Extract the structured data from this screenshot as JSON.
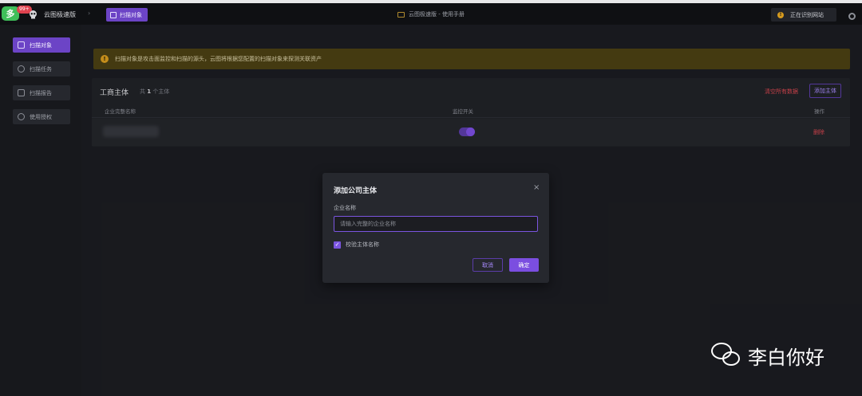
{
  "topbar": {
    "brand_badge": "多",
    "brand_count": "99+",
    "app_name": "云图极速版",
    "current_tab": "扫描对象",
    "center_title": "云图极速版 - 使用手册",
    "status_label": "正在识别网站"
  },
  "sidebar": {
    "items": [
      {
        "label": "扫描对象",
        "icon": "database-icon"
      },
      {
        "label": "扫描任务",
        "icon": "clock-icon"
      },
      {
        "label": "扫描报告",
        "icon": "report-icon"
      },
      {
        "label": "使用授权",
        "icon": "user-icon"
      }
    ]
  },
  "banner": {
    "text": "扫描对象是攻击面监控和扫描的源头，云图将根据您配置的扫描对象来探测关联资产"
  },
  "panel": {
    "title": "工商主体",
    "count_prefix": "共",
    "count_value": "1",
    "count_suffix": "个主体",
    "clear_label": "清空所有数据",
    "add_label": "添加主体",
    "columns": [
      "企业完整名称",
      "监控开关",
      "操作"
    ],
    "rows": [
      {
        "monitor_on": true,
        "action": "删除"
      }
    ]
  },
  "modal": {
    "title": "添加公司主体",
    "close_glyph": "×",
    "field_label": "企业名称",
    "field_placeholder": "请输入完整的企业名称",
    "field_value": "",
    "checkbox_label": "校验主体名称",
    "checkbox_checked": true,
    "cancel_label": "取消",
    "ok_label": "确定"
  },
  "watermark": {
    "text": "李白你好"
  },
  "colors": {
    "accent": "#7b4ee0",
    "danger": "#d8464f",
    "warning_bg": "#4a3f13"
  }
}
